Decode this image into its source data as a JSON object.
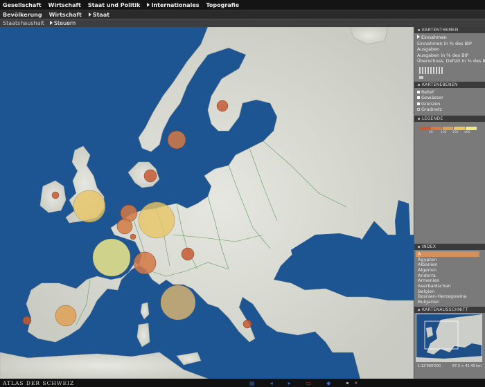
{
  "menu": {
    "items": [
      "Gesellschaft",
      "Wirtschaft",
      "Staat und Politik",
      "Internationales",
      "Topografie"
    ]
  },
  "submenu": {
    "items": [
      "Bevölkerung",
      "Wirtschaft",
      "Staat"
    ]
  },
  "breadcrumb": {
    "items": [
      "Staatshaushalt",
      "Steuern"
    ]
  },
  "panel": {
    "themes_title": "KARTENTHEMEN",
    "themes": [
      "Einnahmen",
      "Einnahmen in % des BIP",
      "Ausgaben",
      "Ausgaben in % des BIP",
      "Überschuss, Defizit in % des BIP"
    ],
    "layers_title": "KARTENEBENEN",
    "layers": [
      "Relief",
      "Gewässer",
      "Grenzen",
      "Gradnetz"
    ],
    "legend_title": "LEGENDE",
    "legend_colors": [
      "#c55a33",
      "#d37a45",
      "#dfa055",
      "#e8c665",
      "#eee98a"
    ],
    "legend_ticks": [
      "50",
      "100",
      "200",
      "400"
    ],
    "index_title": "INDEX",
    "index_selected": "A",
    "index_items": [
      "Ägypten",
      "Albanien",
      "Algerien",
      "Andorra",
      "Armenien",
      "Aserbaidschan",
      "Belgien",
      "Bosnien-Herzegowina",
      "Bulgarien"
    ],
    "overview_title": "KARTENAUSSCHNITT",
    "scale": "1:12'000'000",
    "extent": "67.3 × 41.45 km"
  },
  "footer": {
    "brand": "ATLAS DER SCHWEIZ"
  },
  "colors": {
    "sea": "#1d5592",
    "land": "#d8d9d2",
    "panel": "#7a7a7a",
    "index_highlight": "#d4905c"
  }
}
